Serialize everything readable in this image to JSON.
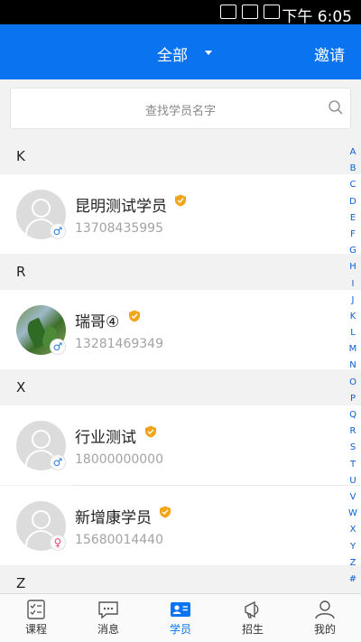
{
  "status_bar": {
    "time": "下午 6:05"
  },
  "header": {
    "title": "全部",
    "invite_label": "邀请"
  },
  "search": {
    "placeholder": "查找学员名字"
  },
  "sections": [
    {
      "letter": "K",
      "students": [
        {
          "name": "昆明测试学员",
          "phone": "13708435995",
          "gender": "male",
          "gender_symbol": "♂",
          "avatar": "default"
        }
      ]
    },
    {
      "letter": "R",
      "students": [
        {
          "name": "瑞哥④",
          "phone": "13281469349",
          "gender": "male",
          "gender_symbol": "♂",
          "avatar": "photo"
        }
      ]
    },
    {
      "letter": "X",
      "students": [
        {
          "name": "行业测试",
          "phone": "18000000000",
          "gender": "male",
          "gender_symbol": "♂",
          "avatar": "default"
        },
        {
          "name": "新增康学员",
          "phone": "15680014440",
          "gender": "female",
          "gender_symbol": "♀",
          "avatar": "default"
        }
      ]
    },
    {
      "letter": "Z",
      "students": []
    }
  ],
  "index_letters": [
    "A",
    "B",
    "C",
    "D",
    "E",
    "F",
    "G",
    "H",
    "I",
    "J",
    "K",
    "L",
    "M",
    "N",
    "O",
    "P",
    "Q",
    "R",
    "S",
    "T",
    "U",
    "V",
    "W",
    "X",
    "Y",
    "Z",
    "#"
  ],
  "tabs": [
    {
      "label": "课程",
      "icon": "course-icon",
      "active": false
    },
    {
      "label": "消息",
      "icon": "message-icon",
      "active": false
    },
    {
      "label": "学员",
      "icon": "student-icon",
      "active": true
    },
    {
      "label": "招生",
      "icon": "recruit-icon",
      "active": false
    },
    {
      "label": "我的",
      "icon": "profile-icon",
      "active": false
    }
  ],
  "colors": {
    "primary": "#0a74f0",
    "badge": "#f2a51a",
    "male": "#2a7be6",
    "female": "#e54a6a"
  }
}
